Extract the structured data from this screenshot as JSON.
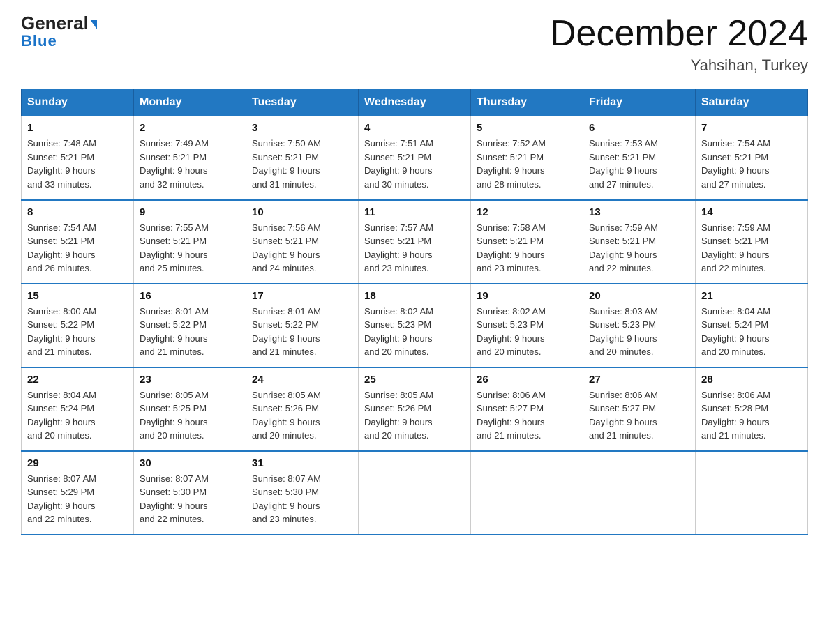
{
  "header": {
    "logo_general": "General",
    "logo_blue": "Blue",
    "title": "December 2024",
    "subtitle": "Yahsihan, Turkey"
  },
  "days_of_week": [
    "Sunday",
    "Monday",
    "Tuesday",
    "Wednesday",
    "Thursday",
    "Friday",
    "Saturday"
  ],
  "weeks": [
    [
      {
        "day": "1",
        "sunrise": "7:48 AM",
        "sunset": "5:21 PM",
        "daylight": "9 hours and 33 minutes."
      },
      {
        "day": "2",
        "sunrise": "7:49 AM",
        "sunset": "5:21 PM",
        "daylight": "9 hours and 32 minutes."
      },
      {
        "day": "3",
        "sunrise": "7:50 AM",
        "sunset": "5:21 PM",
        "daylight": "9 hours and 31 minutes."
      },
      {
        "day": "4",
        "sunrise": "7:51 AM",
        "sunset": "5:21 PM",
        "daylight": "9 hours and 30 minutes."
      },
      {
        "day": "5",
        "sunrise": "7:52 AM",
        "sunset": "5:21 PM",
        "daylight": "9 hours and 28 minutes."
      },
      {
        "day": "6",
        "sunrise": "7:53 AM",
        "sunset": "5:21 PM",
        "daylight": "9 hours and 27 minutes."
      },
      {
        "day": "7",
        "sunrise": "7:54 AM",
        "sunset": "5:21 PM",
        "daylight": "9 hours and 27 minutes."
      }
    ],
    [
      {
        "day": "8",
        "sunrise": "7:54 AM",
        "sunset": "5:21 PM",
        "daylight": "9 hours and 26 minutes."
      },
      {
        "day": "9",
        "sunrise": "7:55 AM",
        "sunset": "5:21 PM",
        "daylight": "9 hours and 25 minutes."
      },
      {
        "day": "10",
        "sunrise": "7:56 AM",
        "sunset": "5:21 PM",
        "daylight": "9 hours and 24 minutes."
      },
      {
        "day": "11",
        "sunrise": "7:57 AM",
        "sunset": "5:21 PM",
        "daylight": "9 hours and 23 minutes."
      },
      {
        "day": "12",
        "sunrise": "7:58 AM",
        "sunset": "5:21 PM",
        "daylight": "9 hours and 23 minutes."
      },
      {
        "day": "13",
        "sunrise": "7:59 AM",
        "sunset": "5:21 PM",
        "daylight": "9 hours and 22 minutes."
      },
      {
        "day": "14",
        "sunrise": "7:59 AM",
        "sunset": "5:21 PM",
        "daylight": "9 hours and 22 minutes."
      }
    ],
    [
      {
        "day": "15",
        "sunrise": "8:00 AM",
        "sunset": "5:22 PM",
        "daylight": "9 hours and 21 minutes."
      },
      {
        "day": "16",
        "sunrise": "8:01 AM",
        "sunset": "5:22 PM",
        "daylight": "9 hours and 21 minutes."
      },
      {
        "day": "17",
        "sunrise": "8:01 AM",
        "sunset": "5:22 PM",
        "daylight": "9 hours and 21 minutes."
      },
      {
        "day": "18",
        "sunrise": "8:02 AM",
        "sunset": "5:23 PM",
        "daylight": "9 hours and 20 minutes."
      },
      {
        "day": "19",
        "sunrise": "8:02 AM",
        "sunset": "5:23 PM",
        "daylight": "9 hours and 20 minutes."
      },
      {
        "day": "20",
        "sunrise": "8:03 AM",
        "sunset": "5:23 PM",
        "daylight": "9 hours and 20 minutes."
      },
      {
        "day": "21",
        "sunrise": "8:04 AM",
        "sunset": "5:24 PM",
        "daylight": "9 hours and 20 minutes."
      }
    ],
    [
      {
        "day": "22",
        "sunrise": "8:04 AM",
        "sunset": "5:24 PM",
        "daylight": "9 hours and 20 minutes."
      },
      {
        "day": "23",
        "sunrise": "8:05 AM",
        "sunset": "5:25 PM",
        "daylight": "9 hours and 20 minutes."
      },
      {
        "day": "24",
        "sunrise": "8:05 AM",
        "sunset": "5:26 PM",
        "daylight": "9 hours and 20 minutes."
      },
      {
        "day": "25",
        "sunrise": "8:05 AM",
        "sunset": "5:26 PM",
        "daylight": "9 hours and 20 minutes."
      },
      {
        "day": "26",
        "sunrise": "8:06 AM",
        "sunset": "5:27 PM",
        "daylight": "9 hours and 21 minutes."
      },
      {
        "day": "27",
        "sunrise": "8:06 AM",
        "sunset": "5:27 PM",
        "daylight": "9 hours and 21 minutes."
      },
      {
        "day": "28",
        "sunrise": "8:06 AM",
        "sunset": "5:28 PM",
        "daylight": "9 hours and 21 minutes."
      }
    ],
    [
      {
        "day": "29",
        "sunrise": "8:07 AM",
        "sunset": "5:29 PM",
        "daylight": "9 hours and 22 minutes."
      },
      {
        "day": "30",
        "sunrise": "8:07 AM",
        "sunset": "5:30 PM",
        "daylight": "9 hours and 22 minutes."
      },
      {
        "day": "31",
        "sunrise": "8:07 AM",
        "sunset": "5:30 PM",
        "daylight": "9 hours and 23 minutes."
      },
      null,
      null,
      null,
      null
    ]
  ],
  "labels": {
    "sunrise": "Sunrise:",
    "sunset": "Sunset:",
    "daylight": "Daylight:"
  }
}
